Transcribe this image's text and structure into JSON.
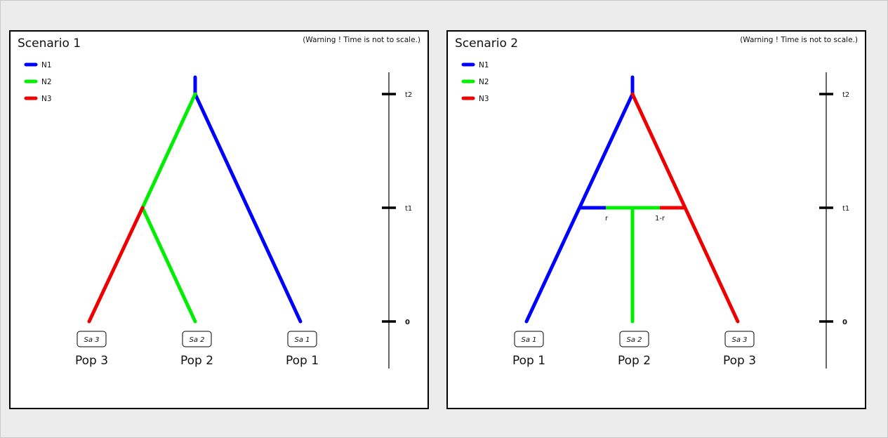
{
  "colors": {
    "N1": "#0000ff",
    "N2": "#00ee00",
    "N3": "#ee0000",
    "axis": "#000000",
    "background": "#ececec"
  },
  "scenarios": [
    {
      "title": "Scenario 1",
      "warning": "(Warning ! Time is not to scale.)",
      "legend": [
        "N1",
        "N2",
        "N3"
      ],
      "time_ticks": [
        "t2",
        "t1",
        "0"
      ],
      "samples": [
        "Sa 3",
        "Sa 2",
        "Sa 1"
      ],
      "populations": [
        "Pop 3",
        "Pop 2",
        "Pop 1"
      ]
    },
    {
      "title": "Scenario 2",
      "warning": "(Warning ! Time is not to scale.)",
      "legend": [
        "N1",
        "N2",
        "N3"
      ],
      "time_ticks": [
        "t2",
        "t1",
        "0"
      ],
      "samples": [
        "Sa 1",
        "Sa 2",
        "Sa 3"
      ],
      "populations": [
        "Pop 1",
        "Pop 2",
        "Pop 3"
      ],
      "admixture_labels": [
        "r",
        "1-r"
      ]
    }
  ]
}
